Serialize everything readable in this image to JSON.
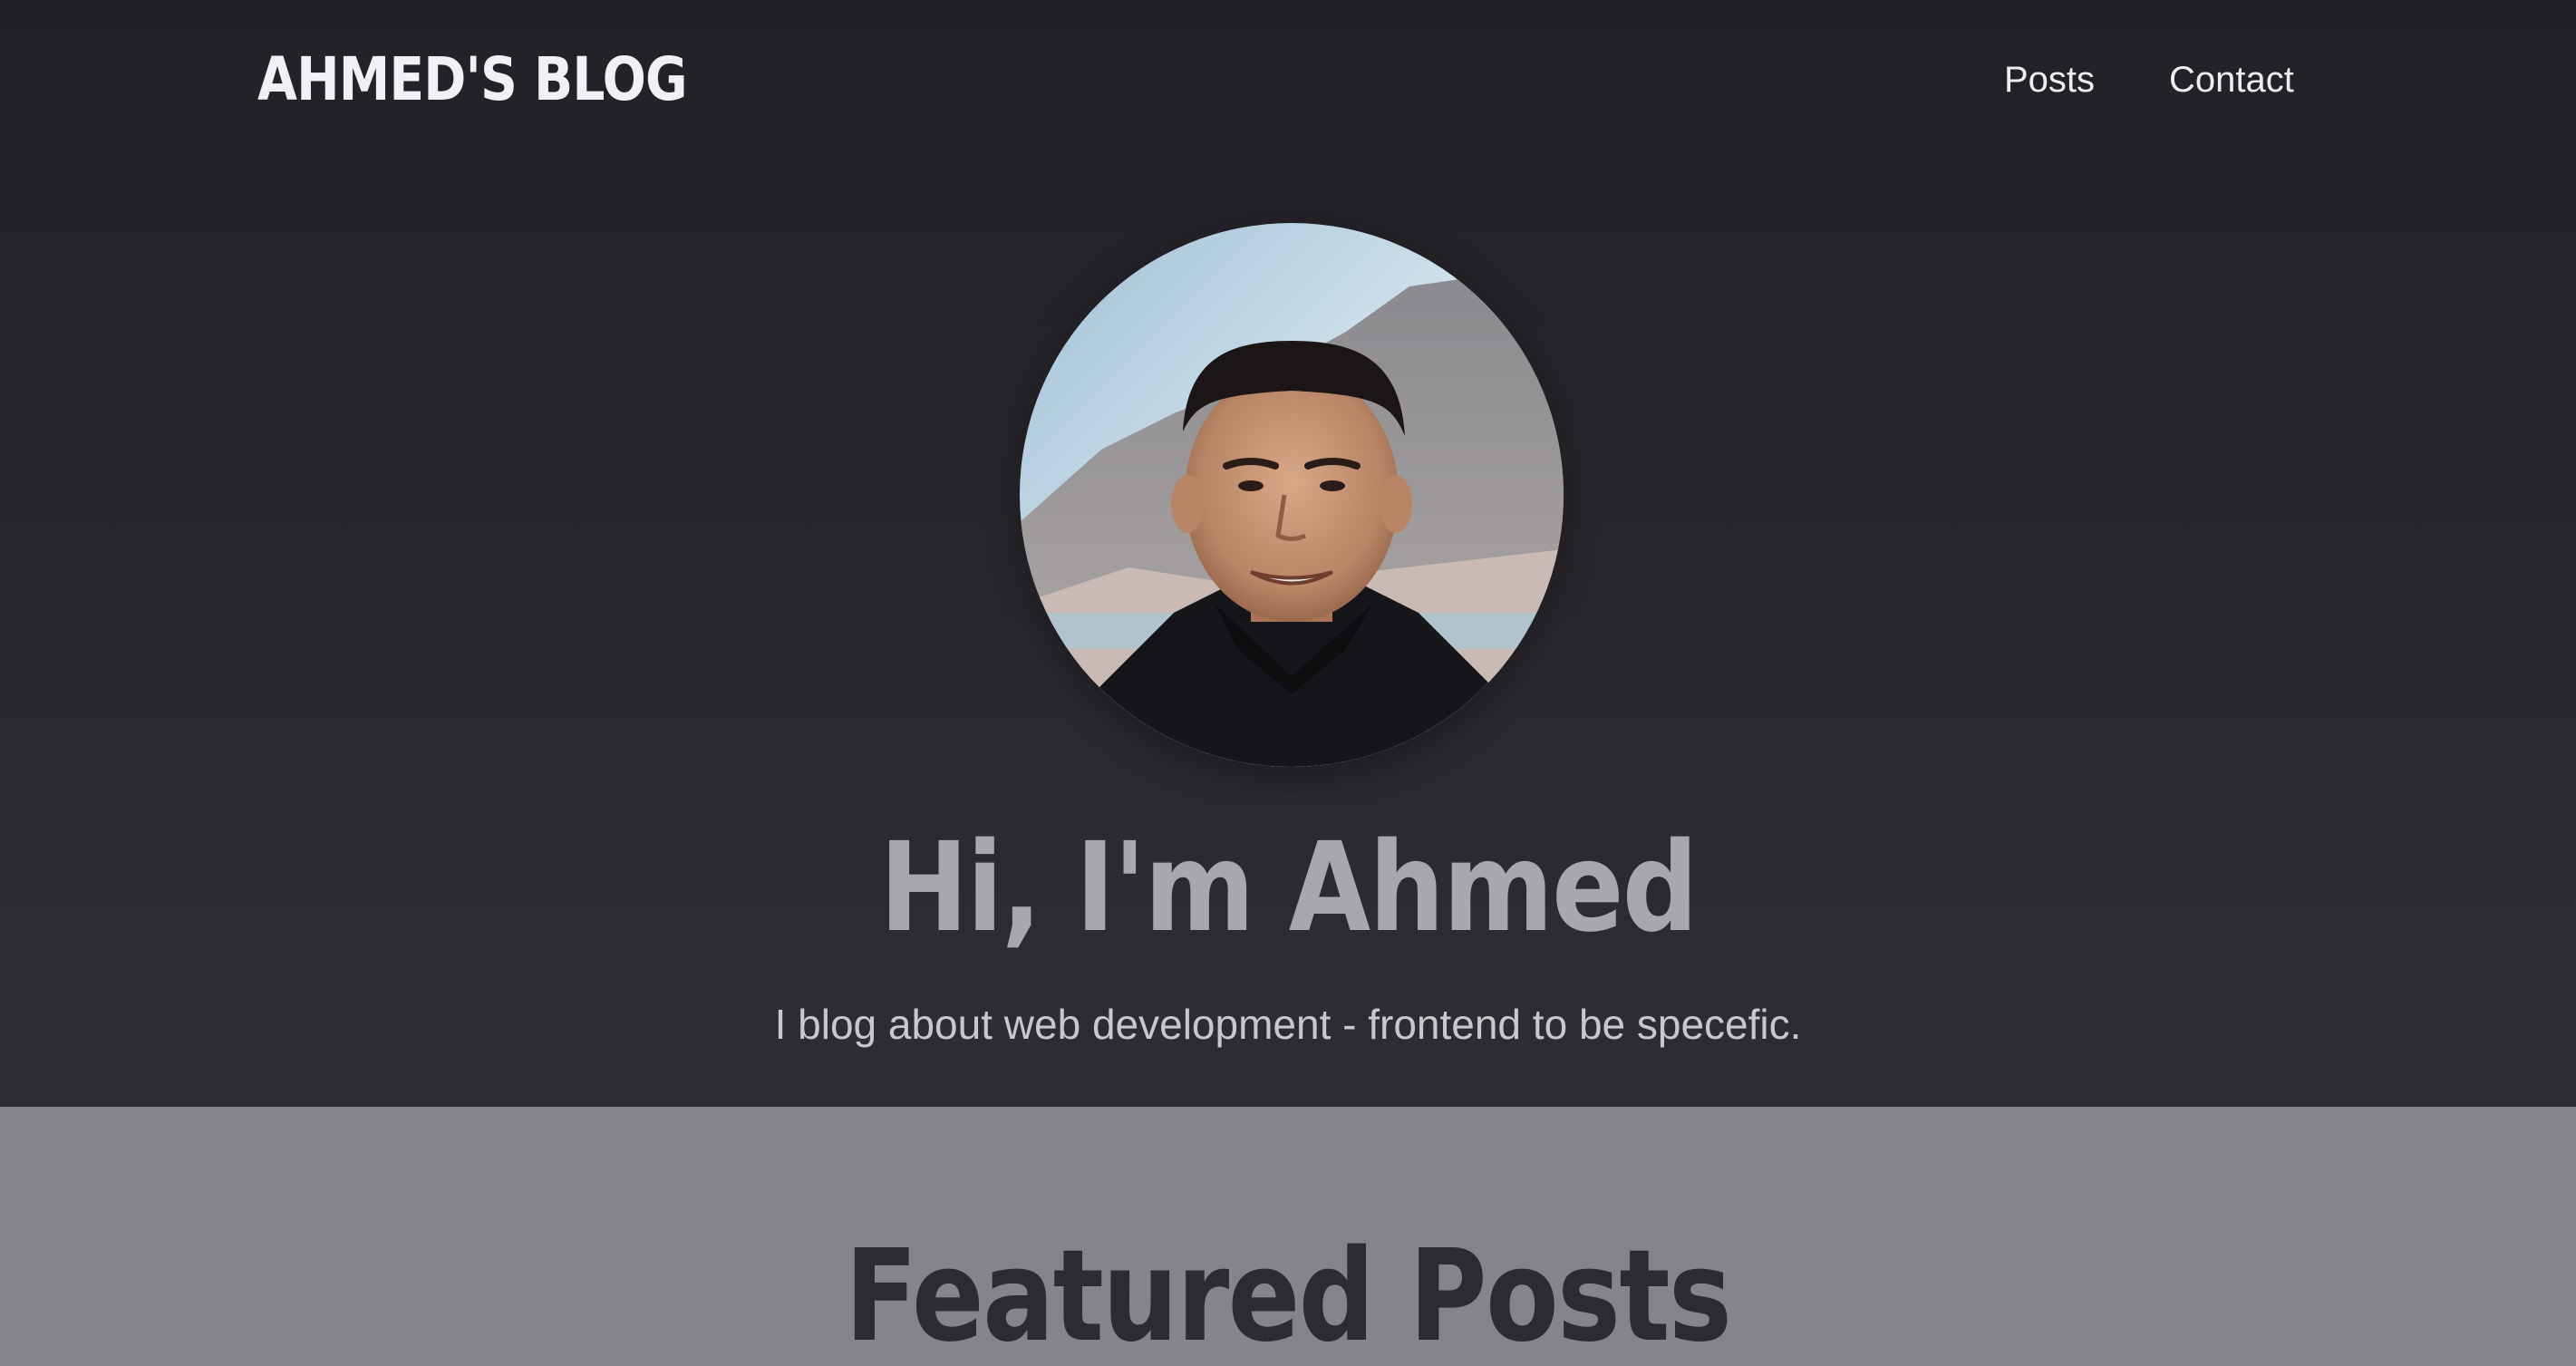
{
  "header": {
    "logo": "AHMED'S BLOG",
    "nav": [
      {
        "label": "Posts"
      },
      {
        "label": "Contact"
      }
    ]
  },
  "hero": {
    "title": "Hi, I'm Ahmed",
    "subtitle": "I blog about web development - frontend to be specefic."
  },
  "featured": {
    "title": "Featured Posts"
  },
  "colors": {
    "hero_bg": "#27252b",
    "featured_bg": "#86848b",
    "title_muted": "#a9a7ad",
    "text_light": "#efedf2"
  }
}
